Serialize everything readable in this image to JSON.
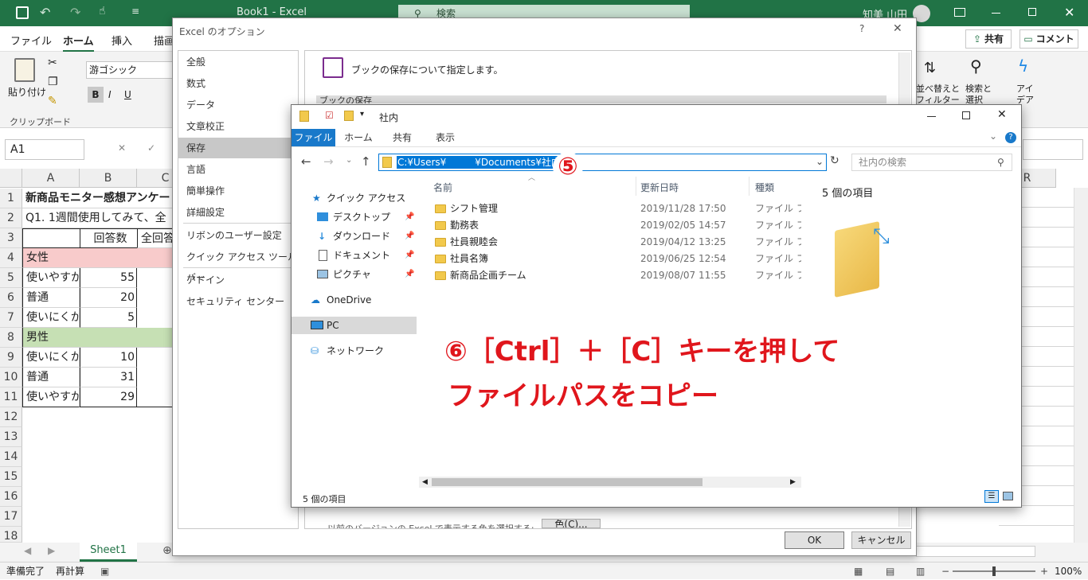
{
  "excel": {
    "title": "Book1  -  Excel",
    "search_placeholder": "検索",
    "user": "知美 山田",
    "tabs": [
      "ファイル",
      "ホーム",
      "挿入",
      "描画"
    ],
    "share": "共有",
    "comment": "コメント",
    "paste": "貼り付け",
    "clipboard": "クリップボード",
    "font_name": "游ゴシック",
    "sort_filter": "並べ替えと\nフィルター",
    "find_select": "検索と\n選択",
    "idea": "アイ\nデア",
    "name_box": "A1",
    "columns": [
      "A",
      "B",
      "C",
      "R"
    ],
    "rows": [
      "1",
      "2",
      "3",
      "4",
      "5",
      "6",
      "7",
      "8",
      "9",
      "10",
      "11",
      "12",
      "13",
      "14",
      "15",
      "16",
      "17",
      "18"
    ],
    "cells": {
      "r1": "新商品モニター感想アンケー",
      "r2": "Q1. 1週間使用してみて、全",
      "r3b": "回答数",
      "r3c": "全回答",
      "r4": "女性",
      "r5a": "使いやすか",
      "r5b": "55",
      "r6a": "普通",
      "r6b": "20",
      "r7a": "使いにくか",
      "r7b": "5",
      "r8": "男性",
      "r9a": "使いにくか",
      "r9b": "10",
      "r10a": "普通",
      "r10b": "31",
      "r11a": "使いやすか",
      "r11b": "29"
    },
    "sheet_tab": "Sheet1",
    "status_ready": "準備完了",
    "status_recalc": "再計算",
    "zoom": "100%"
  },
  "options_dialog": {
    "title": "Excel のオプション",
    "help": "?",
    "nav": [
      "全般",
      "数式",
      "データ",
      "文章校正",
      "保存",
      "言語",
      "簡単操作",
      "詳細設定",
      "リボンのユーザー設定",
      "クイック アクセス ツール バー",
      "アドイン",
      "セキュリティ センター"
    ],
    "selected_nav": "保存",
    "heading": "ブックの保存について指定します。",
    "section": "ブックの保存",
    "bottom_text": "以前のバージョンの Excel で表示する色を選択する:",
    "color_button": "色(C)...",
    "ok": "OK",
    "cancel": "キャンセル"
  },
  "explorer": {
    "title": "社内",
    "ribbon_tabs": [
      "ファイル",
      "ホーム",
      "共有",
      "表示"
    ],
    "address": "C:¥Users¥　　　¥Documents¥社内",
    "search_placeholder": "社内の検索",
    "nav_items": [
      "クイック アクセス",
      "デスクトップ",
      "ダウンロード",
      "ドキュメント",
      "ピクチャ",
      "OneDrive",
      "PC",
      "ネットワーク"
    ],
    "col_name": "名前",
    "col_date": "更新日時",
    "col_type": "種類",
    "files": [
      {
        "name": "シフト管理",
        "date": "2019/11/28 17:50",
        "type": "ファイル フォル"
      },
      {
        "name": "勤務表",
        "date": "2019/02/05 14:57",
        "type": "ファイル フォル"
      },
      {
        "name": "社員親睦会",
        "date": "2019/04/12 13:25",
        "type": "ファイル フォル"
      },
      {
        "name": "社員名簿",
        "date": "2019/06/25 12:54",
        "type": "ファイル フォル"
      },
      {
        "name": "新商品企画チーム",
        "date": "2019/08/07 11:55",
        "type": "ファイル フォル"
      }
    ],
    "preview_count": "5 個の項目",
    "status_count": "5 個の項目"
  },
  "annotations": {
    "step5": "⑤",
    "step6_line1": "⑥［Ctrl］＋［C］キーを押して",
    "step6_line2": "ファイルパスをコピー"
  },
  "colors": {
    "excel_green": "#217346",
    "female_fill": "#f8cbcb",
    "male_fill": "#c6e0b4",
    "annotation_red": "#e0161c",
    "selection_blue": "#0078d7"
  }
}
